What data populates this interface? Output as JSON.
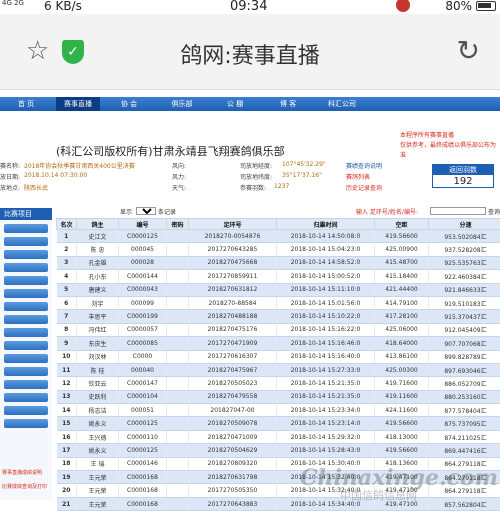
{
  "status_bar": {
    "signal": "4G 2G",
    "network_speed": "6 KB/s",
    "time": "09:34",
    "battery": "80%"
  },
  "browser": {
    "title": "鸽网:赛事直播",
    "icons": [
      "star-icon",
      "shield-icon",
      "reload-icon"
    ]
  },
  "nav": {
    "items": [
      "首 页",
      "赛事直播",
      "协 会",
      "俱乐部",
      "公 棚",
      "博 客",
      "科汇公司"
    ],
    "active_index": 1
  },
  "header": {
    "club_title": "(科汇公司版权所有)甘肃永靖县飞翔赛鸽俱乐部",
    "notice_line1": "本程序所有赛事直播",
    "notice_line2": "仅供参考，最终成绩以俱乐部公布为准"
  },
  "info": {
    "race_name_label": "赛名称:",
    "race_name": "2018年协会秋季赛甘肃西关400公里决赛",
    "release_time_label": "放日期:",
    "release_time": "2018.10.14 07:30:00",
    "release_place_label": "放地点:",
    "release_place": "陕西长武",
    "wind1_label": "风向:",
    "wind2_label": "风力:",
    "weather_label": "天气:",
    "coord1_label": "司放地经度:",
    "coord1": "107°45'32.29\"",
    "coord2_label": "司放地纬度:",
    "coord2": "35°17'37.16\"",
    "entries_label": "参赛羽数:",
    "entries": "1237",
    "link1": "赛绩查询说明",
    "link2": "赛鸽列表",
    "link3": "历史记录查询"
  },
  "return_count": {
    "label": "返回羽数",
    "value": "192"
  },
  "sidebar": {
    "header": "比赛项目",
    "links": [
      "赛事直播成绩说明",
      "比赛成绩查询及打印"
    ]
  },
  "toolbar": {
    "show_label": "显示",
    "page_size": "100",
    "records_label": "条记录",
    "search_label": "输入 足环号/姓名/编号:",
    "search_button": "查询"
  },
  "table": {
    "columns": [
      "名次",
      "鸽主",
      "编号",
      "密码",
      "足环号",
      "归巢时间",
      "空距",
      "分速"
    ],
    "rows": [
      [
        "1",
        "史江文",
        "C0000125",
        "",
        "2018270-0054876",
        "2018-10-14 14:50:08:0",
        "419.56600",
        "953.502084汇"
      ],
      [
        "2",
        "陈 忠",
        "000045",
        "",
        "2017270643285",
        "2018-10-14 15:04:23:0",
        "425.00900",
        "937.528208汇"
      ],
      [
        "3",
        "孔金雄",
        "000028",
        "",
        "2018270475668",
        "2018-10-14 14:58:52:0",
        "415.48700",
        "925.535763汇"
      ],
      [
        "4",
        "孔小东",
        "C0000144",
        "",
        "2017270859911",
        "2018-10-14 15:00:52:0",
        "415.18400",
        "922.460384汇"
      ],
      [
        "5",
        "唐建义",
        "C0000043",
        "",
        "2018270631812",
        "2018-10-14 15:11:10:0",
        "421.44400",
        "921.846633汇"
      ],
      [
        "6",
        "刘宇",
        "000099",
        "",
        "2018270-88584",
        "2018-10-14 15:01:56:0",
        "414.79100",
        "919.510183汇"
      ],
      [
        "7",
        "丰思平",
        "C0000199",
        "",
        "2018270488188",
        "2018-10-14 15:10:22:0",
        "417.28100",
        "915.370437汇"
      ],
      [
        "8",
        "冯伟红",
        "C0000057",
        "",
        "2018270475176",
        "2018-10-14 15:16:22:0",
        "425.06000",
        "912.045409汇"
      ],
      [
        "9",
        "东庆生",
        "C0000085",
        "",
        "2017270471909",
        "2018-10-14 15:16:46:0",
        "418.64000",
        "907.707068汇"
      ],
      [
        "10",
        "刘汉林",
        "C0000",
        "",
        "2017270616307",
        "2018-10-14 15:16:40:0",
        "413.86100",
        "899.828789汇"
      ],
      [
        "11",
        "陈 桂",
        "000040",
        "",
        "2018270475967",
        "2018-10-14 15:27:33:0",
        "425.00300",
        "897.693046汇"
      ],
      [
        "12",
        "钦亚云",
        "C0000147",
        "",
        "2018270505023",
        "2018-10-14 15:21:35:0",
        "419.71600",
        "886.052709汇"
      ],
      [
        "13",
        "史跃利",
        "C0000104",
        "",
        "2018270479558",
        "2018-10-14 15:21:35:0",
        "419.11600",
        "880.253160汇"
      ],
      [
        "14",
        "杨志洁",
        "000051",
        "",
        "201827047-00",
        "2018-10-14 15:23:34:0",
        "424.11600",
        "877.578404汇"
      ],
      [
        "15",
        "姚永义",
        "C0000125",
        "",
        "2018270509078",
        "2018-10-14 15:23:14:0",
        "419.56600",
        "875.737095汇"
      ],
      [
        "16",
        "王兴德",
        "C0000110",
        "",
        "2018270471009",
        "2018-10-14 15:29:32:0",
        "418.13000",
        "874.211025汇"
      ],
      [
        "17",
        "姚永义",
        "C0000125",
        "",
        "2018270504629",
        "2018-10-14 15:28:43:0",
        "419.56600",
        "869.447416汇"
      ],
      [
        "18",
        "王 瑞",
        "C0000146",
        "",
        "2018270809320",
        "2018-10-14 15:30:40:0",
        "418.13600",
        "864.279118汇"
      ],
      [
        "19",
        "王元荣",
        "C0000168",
        "",
        "2018270631798",
        "2018-10-14 15:32:40:0",
        "419.47100",
        "864.279118汇"
      ],
      [
        "20",
        "王元荣",
        "C0000168",
        "",
        "2017270505350",
        "2018-10-14 15:32:40:0",
        "419.47100",
        "864.279118汇"
      ],
      [
        "21",
        "王元荣",
        "C0000168",
        "",
        "2017270643883",
        "2018-10-14 15:34:40:0",
        "419.47100",
        "857.562804汇"
      ]
    ]
  },
  "watermark": {
    "text": "Chinaxinge.com",
    "subtext": "中国信鸽信息网"
  }
}
